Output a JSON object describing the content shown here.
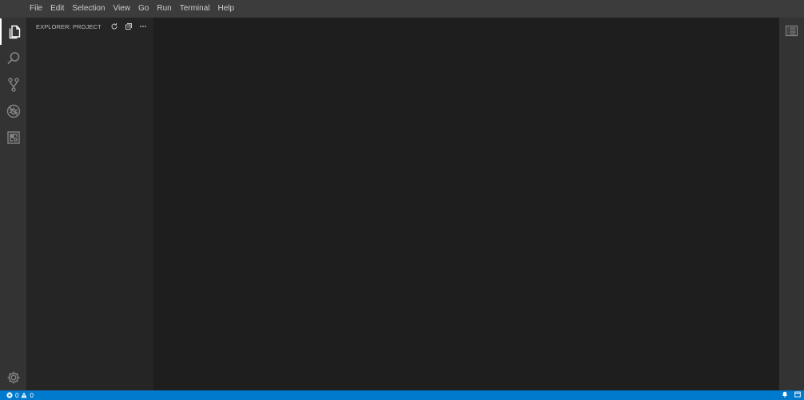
{
  "menubar": {
    "items": [
      "File",
      "Edit",
      "Selection",
      "View",
      "Go",
      "Run",
      "Terminal",
      "Help"
    ]
  },
  "activitybar": {
    "items": [
      {
        "icon": "explorer-icon",
        "active": true
      },
      {
        "icon": "search-icon",
        "active": false
      },
      {
        "icon": "source-control-icon",
        "active": false
      },
      {
        "icon": "debug-icon",
        "active": false
      },
      {
        "icon": "extensions-icon",
        "active": false
      }
    ],
    "bottom": {
      "icon": "gear-icon"
    }
  },
  "sidebar": {
    "title": "EXPLORER: PROJECT",
    "actions": [
      "refresh-icon",
      "collapse-all-icon",
      "more-icon"
    ]
  },
  "rightbar": {
    "icon": "outline-list-icon"
  },
  "statusbar": {
    "errors": "0",
    "warnings": "0",
    "right_icons": [
      "bell-icon",
      "panel-icon"
    ]
  },
  "colors": {
    "menubar": "#3c3c3c",
    "activitybar": "#333333",
    "sidebar": "#252526",
    "editor": "#1e1e1e",
    "statusbar": "#007acc"
  }
}
